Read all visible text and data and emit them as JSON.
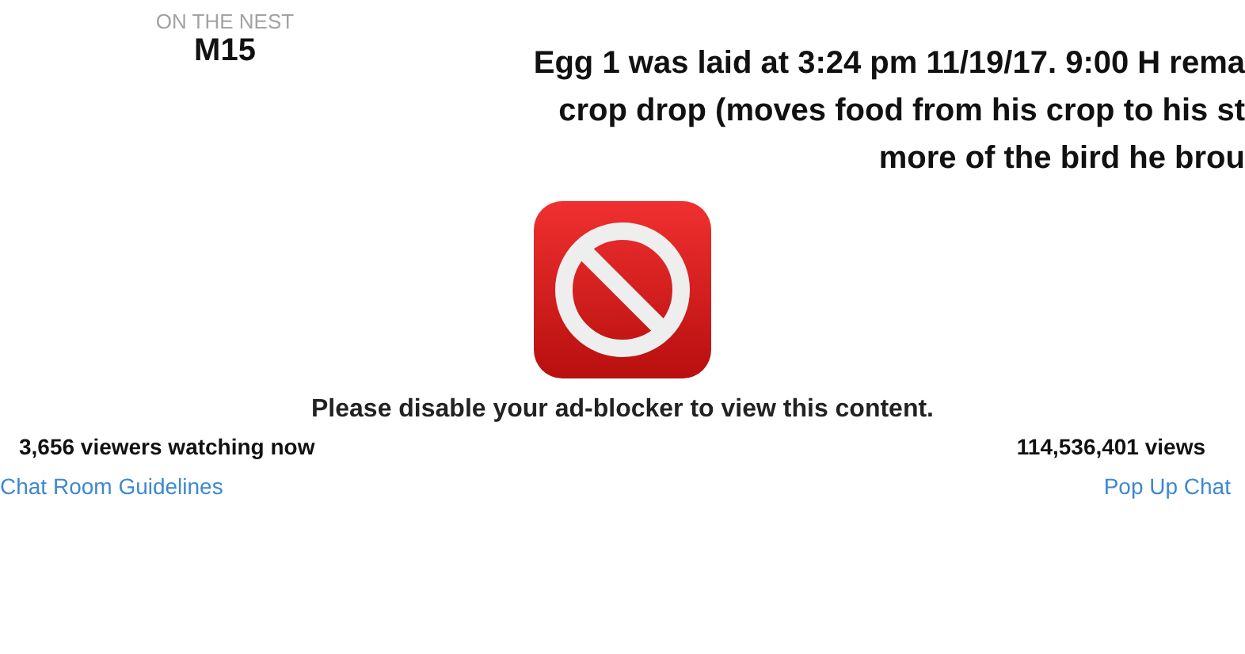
{
  "nest": {
    "label": "ON THE NEST",
    "name": "M15"
  },
  "description": [
    "Egg 1 was laid at 3:24 pm 11/19/17. 9:00 H rema",
    "crop drop (moves food from his crop to his st",
    "more of the bird he brou"
  ],
  "player": {
    "message": "Please disable your ad-blocker to view this content."
  },
  "stats": {
    "viewers": "3,656 viewers watching now",
    "views": "114,536,401 views"
  },
  "links": [
    "Chat Room Guidelines",
    "Pop Up Chat"
  ]
}
